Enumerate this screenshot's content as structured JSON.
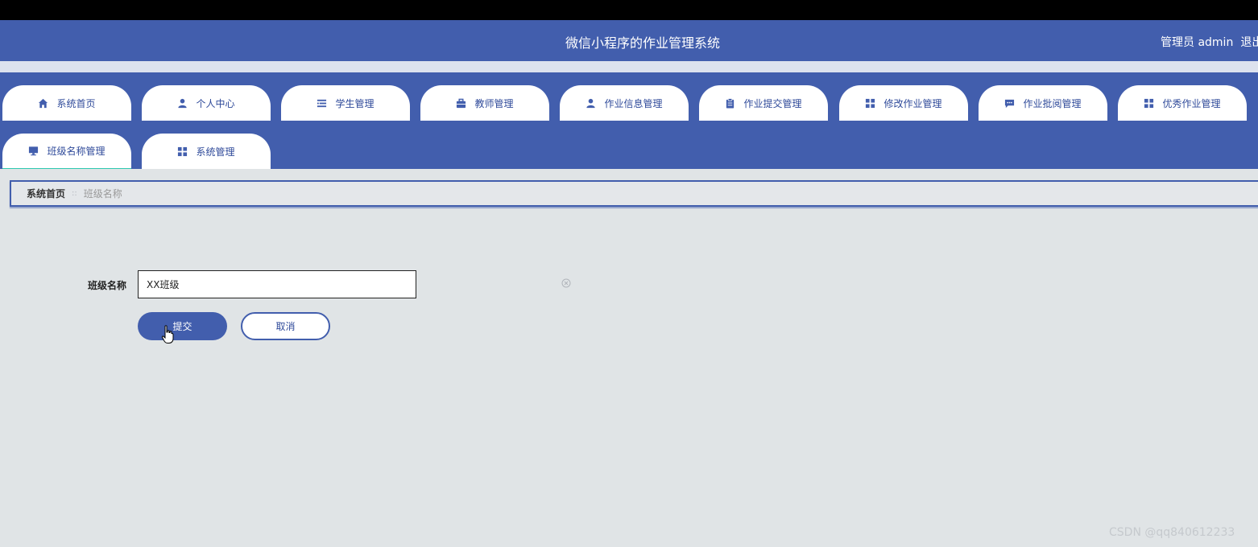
{
  "header": {
    "title": "微信小程序的作业管理系统",
    "user_label": "管理员 admin",
    "logout_label": "退出"
  },
  "nav": {
    "items": [
      {
        "label": "系统首页",
        "icon": "home-icon"
      },
      {
        "label": "个人中心",
        "icon": "user-icon"
      },
      {
        "label": "学生管理",
        "icon": "list-icon"
      },
      {
        "label": "教师管理",
        "icon": "briefcase-icon"
      },
      {
        "label": "作业信息管理",
        "icon": "user-icon"
      },
      {
        "label": "作业提交管理",
        "icon": "clipboard-icon"
      },
      {
        "label": "修改作业管理",
        "icon": "grid-icon"
      },
      {
        "label": "作业批阅管理",
        "icon": "comment-icon"
      },
      {
        "label": "优秀作业管理",
        "icon": "grid-icon"
      },
      {
        "label": "班级名称管理",
        "icon": "monitor-icon"
      },
      {
        "label": "系统管理",
        "icon": "grid-icon"
      }
    ],
    "active_index": 9
  },
  "breadcrumb": {
    "home": "系统首页",
    "separator": "::",
    "current": "班级名称"
  },
  "form": {
    "field_label": "班级名称",
    "field_value": "XX班级",
    "submit_label": "提交",
    "cancel_label": "取消"
  },
  "watermark": "CSDN @qq840612233",
  "colors": {
    "primary": "#425ead",
    "background": "#e0e4e6",
    "active_underline": "#2ec9b0"
  }
}
